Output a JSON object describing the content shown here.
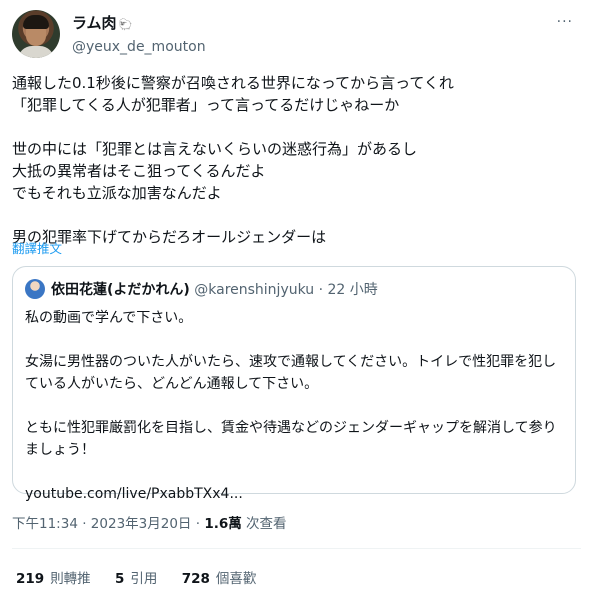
{
  "author": {
    "display_name": "ラム肉",
    "emoji": "🐑",
    "handle": "@yeux_de_mouton"
  },
  "more_icon": "···",
  "tweet": {
    "text": "通報した0.1秒後に警察が召喚される世界になってから言ってくれ\n「犯罪してくる人が犯罪者」って言ってるだけじゃねーか\n\n世の中には「犯罪とは言えないくらいの迷惑行為」があるし\n大抵の異常者はそこ狙ってくるんだよ\nでもそれも立派な加害なんだよ\n\n男の犯罪率下げてからだろオールジェンダーは",
    "translate_label": "翻譯推文"
  },
  "quote": {
    "display_name": "依田花蓮(よだかれん)",
    "handle": "@karenshinjyuku",
    "separator": "·",
    "time": "22 小時",
    "text": "私の動画で学んで下さい。\n\n女湯に男性器のついた人がいたら、速攻で通報してください。トイレで性犯罪を犯している人がいたら、どんどん通報して下さい。\n\nともに性犯罪厳罰化を目指し、賃金や待遇などのジェンダーギャップを解消して参りましょう！\n\nyoutube.com/live/PxabbTXx4..."
  },
  "meta": {
    "time": "下午11:34",
    "separator": "·",
    "date": "2023年3月20日",
    "views_count": "1.6萬",
    "views_label": "次查看"
  },
  "stats": {
    "retweets_count": "219",
    "retweets_label": "則轉推",
    "quotes_count": "5",
    "quotes_label": "引用",
    "likes_count": "728",
    "likes_label": "個喜歡"
  }
}
